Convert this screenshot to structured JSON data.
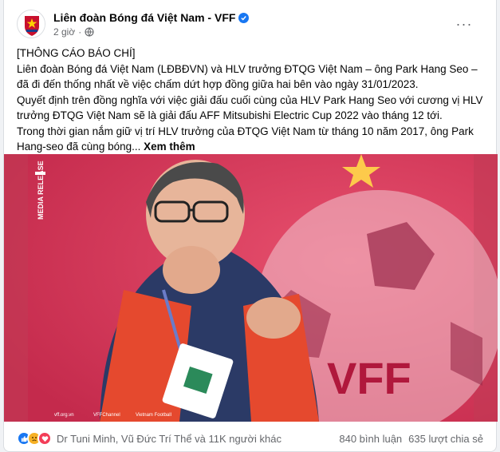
{
  "post": {
    "page_name": "Liên đoàn Bóng đá Việt Nam - VFF",
    "time": "2 giờ",
    "separator": "·",
    "more_label": "···",
    "lines": [
      "[THÔNG CÁO BÁO CHÍ]",
      "Liên đoàn Bóng đá Việt Nam (LĐBĐVN) và HLV trưởng ĐTQG Việt Nam – ông Park Hang Seo – đã đi đến thống nhất về việc chấm dứt hợp đồng giữa hai bên vào ngày 31/01/2023.",
      "Quyết định trên đồng nghĩa với việc giải đấu cuối cùng của HLV Park Hang Seo với cương vị HLV trưởng ĐTQG Việt Nam sẽ là giải đấu AFF Mitsubishi Electric Cup 2022 vào tháng 12 tới.",
      "Trong thời gian nắm giữ vị trí HLV trưởng của ĐTQG Việt Nam từ tháng 10 năm 2017, ông Park Hang-seo đã cùng bóng..."
    ],
    "see_more": "Xem thêm"
  },
  "image": {
    "badge_text": "MEDIA RELEASE",
    "logo_text": "VFF",
    "footer_links": [
      "vff.org.vn",
      "VFFChannel",
      "Vietnam Football"
    ]
  },
  "footer": {
    "reactors": "Dr Tuni Minh, Vũ Đức Trí Thể và 11K người khác",
    "comments": "840 bình luận",
    "shares": "635 lượt chia sẻ"
  },
  "colors": {
    "like": "#1877f2",
    "sad": "#f7b125",
    "love": "#f33e58",
    "image_bg": "#d8385a"
  }
}
